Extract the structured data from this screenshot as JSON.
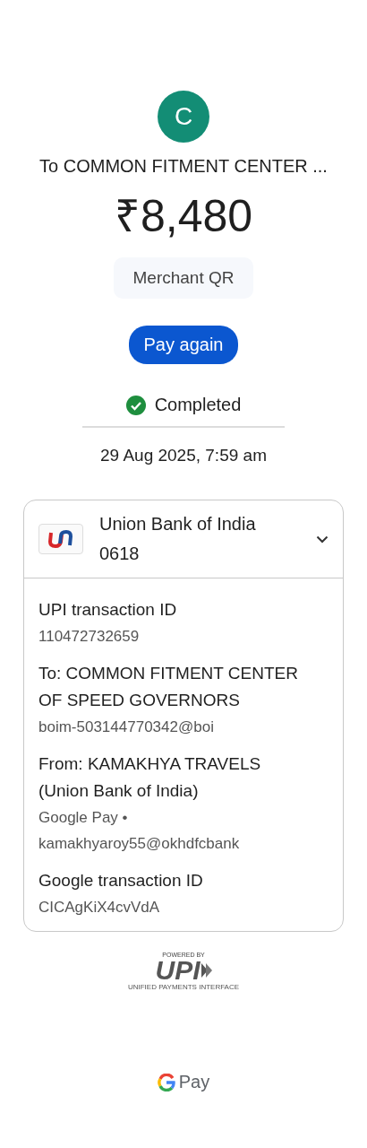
{
  "payee": {
    "initial": "C",
    "title": "To COMMON FITMENT CENTER ..."
  },
  "amount": "₹8,480",
  "payment_type": "Merchant QR",
  "action_button": "Pay again",
  "status": {
    "kind": "success",
    "text": "Completed"
  },
  "timestamp": "29 Aug 2025, 7:59 am",
  "account": {
    "bank": "Union Bank of India",
    "number": "0618"
  },
  "details": [
    {
      "label": "UPI transaction ID",
      "value": "110472732659"
    },
    {
      "label": "To: COMMON FITMENT CENTER OF SPEED GOVERNORS",
      "value": "boim-503144770342@boi"
    },
    {
      "label": "From: KAMAKHYA TRAVELS (Union Bank of India)",
      "value": "Google Pay • kamakhyaroy55@okhdfcbank"
    },
    {
      "label": "Google transaction ID",
      "value": "CICAgKiX4cvVdA"
    }
  ],
  "footer": {
    "powered_by": "POWERED BY",
    "upi": "UPI",
    "upi_tagline": "UNIFIED PAYMENTS INTERFACE",
    "brand": "Pay"
  }
}
